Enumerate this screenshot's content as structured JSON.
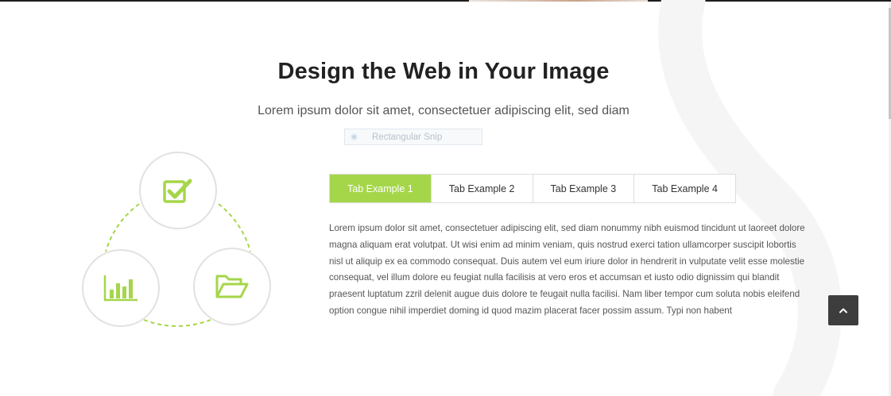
{
  "section": {
    "title": "Design the Web in Your Image",
    "subtitle": "Lorem ipsum dolor sit amet, consectetuer adipiscing elit, sed diam"
  },
  "snip_overlay": {
    "label": "Rectangular Snip",
    "icon": "snip-icon"
  },
  "diagram": {
    "accent_color": "#a5d64a",
    "icons": [
      "check-square-icon",
      "bar-chart-icon",
      "folder-open-icon"
    ]
  },
  "tabs": [
    {
      "label": "Tab Example 1",
      "active": true
    },
    {
      "label": "Tab Example 2",
      "active": false
    },
    {
      "label": "Tab Example 3",
      "active": false
    },
    {
      "label": "Tab Example 4",
      "active": false
    }
  ],
  "tab_content": {
    "text": "Lorem ipsum dolor sit amet, consectetuer adipiscing elit, sed diam nonummy nibh euismod tincidunt ut laoreet dolore magna aliquam erat volutpat. Ut wisi enim ad minim veniam, quis nostrud exerci tation ullamcorper suscipit lobortis nisl ut aliquip ex ea commodo consequat. Duis autem vel eum iriure dolor in hendrerit in vulputate velit esse molestie consequat, vel illum dolore eu feugiat nulla facilisis at vero eros et accumsan et iusto odio dignissim qui blandit praesent luptatum zzril delenit augue duis dolore te feugait nulla facilisi. Nam liber tempor cum soluta nobis eleifend option congue nihil imperdiet doming id quod mazim placerat facer possim assum. Typi non habent"
  },
  "back_to_top": {
    "icon": "chevron-up-icon"
  },
  "colors": {
    "accent": "#a5d64a",
    "dark_button": "#3d3d3d",
    "title_text": "#222222"
  }
}
